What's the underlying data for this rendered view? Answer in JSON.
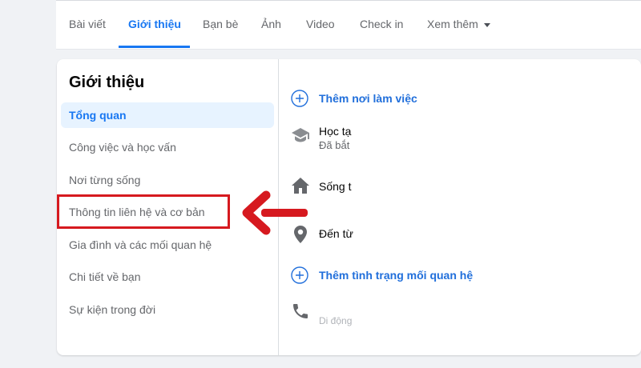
{
  "tabs": [
    {
      "label": "Bài viết",
      "active": false
    },
    {
      "label": "Giới thiệu",
      "active": true
    },
    {
      "label": "Bạn bè",
      "active": false
    },
    {
      "label": "Ảnh",
      "active": false
    },
    {
      "label": "Video",
      "active": false
    },
    {
      "label": "Check in",
      "active": false
    },
    {
      "label": "Xem thêm",
      "active": false
    }
  ],
  "about": {
    "title": "Giới thiệu",
    "items": [
      {
        "label": "Tổng quan",
        "active": true
      },
      {
        "label": "Công việc và học vấn",
        "active": false
      },
      {
        "label": "Nơi từng sống",
        "active": false
      },
      {
        "label": "Thông tin liên hệ và cơ bản",
        "active": false,
        "highlighted": true
      },
      {
        "label": "Gia đình và các mối quan hệ",
        "active": false
      },
      {
        "label": "Chi tiết về bạn",
        "active": false
      },
      {
        "label": "Sự kiện trong đời",
        "active": false
      }
    ]
  },
  "overview": {
    "add_workplace": "Thêm nơi làm việc",
    "education_line1": "Học tạ",
    "education_line2": "Đã bắt",
    "lives_in": "Sống t",
    "from": "Đến từ",
    "add_relationship": "Thêm tình trạng mối quan hệ",
    "phone": "Di động"
  },
  "colors": {
    "accent": "#1877f2",
    "highlight": "#d6191f",
    "active_bg": "#e7f3ff"
  },
  "icons": [
    "plus-circle-icon",
    "graduation-cap-icon",
    "home-icon",
    "location-pin-icon",
    "phone-icon",
    "caret-down-icon",
    "red-arrow-icon"
  ]
}
